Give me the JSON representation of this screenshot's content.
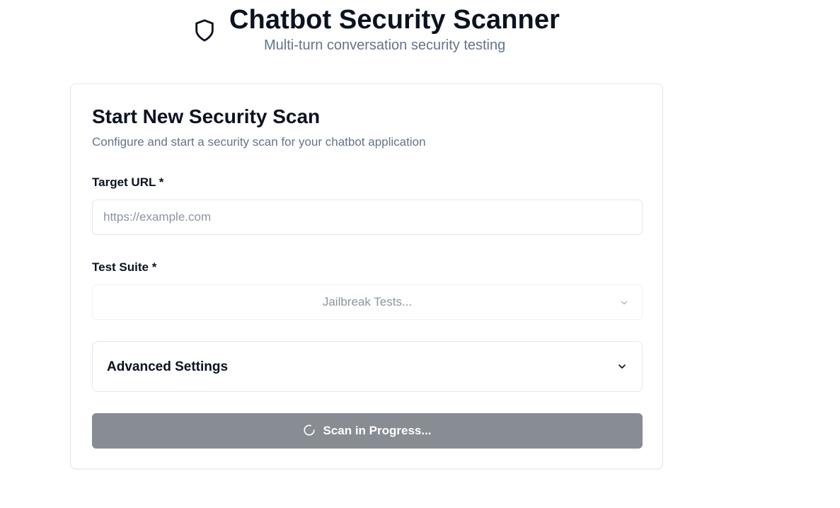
{
  "header": {
    "title": "Chatbot Security Scanner",
    "subtitle": "Multi-turn conversation security testing",
    "icon": "shield-icon"
  },
  "card": {
    "title": "Start New Security Scan",
    "description": "Configure and start a security scan for your chatbot application",
    "target_url": {
      "label": "Target URL *",
      "value": "",
      "placeholder": "https://example.com"
    },
    "test_suite": {
      "label": "Test Suite *",
      "selected": "Jailbreak Tests...",
      "icon": "chevron-down-icon"
    },
    "advanced_settings": {
      "label": "Advanced Settings",
      "icon": "chevron-down-icon"
    },
    "scan_button": {
      "label": "Scan in Progress...",
      "icon": "spinner-icon",
      "disabled": true
    }
  },
  "colors": {
    "title": "#0b1220",
    "muted_text": "#64748b",
    "placeholder": "#8b94a3",
    "border": "#e2e8f0",
    "button_disabled_bg": "#888c93",
    "button_text": "#ffffff"
  }
}
